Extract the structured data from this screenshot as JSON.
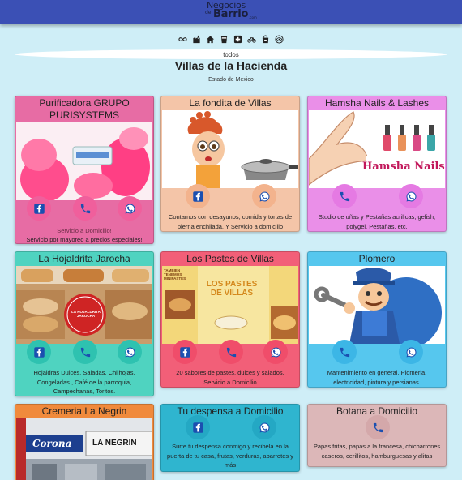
{
  "header": {
    "logo_line1": "Negocios",
    "logo_del": "del",
    "logo_line2": "Barrio",
    "logo_tld": ".com"
  },
  "categories": [
    {
      "name": "infinity-icon",
      "label": "todos"
    },
    {
      "name": "store-icon",
      "label": "tiendas"
    },
    {
      "name": "house-icon",
      "label": "hogar"
    },
    {
      "name": "cup-icon",
      "label": "bebidas"
    },
    {
      "name": "medical-icon",
      "label": "salud"
    },
    {
      "name": "bicycle-icon",
      "label": "transporte"
    },
    {
      "name": "bag-icon",
      "label": "compras"
    },
    {
      "name": "eye-icon",
      "label": "belleza"
    }
  ],
  "filter_label": "todos",
  "page_title": "Villas de la Hacienda",
  "page_subtitle": "Estado de Mexico",
  "colors": {
    "topbar": "#3b50b5",
    "background": "#cfeef7",
    "facebook": "#1877f2",
    "whatsapp": "#25a244",
    "phone": "#3a6df0"
  },
  "cards": [
    {
      "title": "Purificadora GRUPO PURISYSTEMS",
      "image": "water-bottles-photo",
      "description": "Servicio a Domicilio!",
      "description2": "Servicio por mayoreo a precios especiales!"
    },
    {
      "title": "La fondita de Villas",
      "image": "cook-cartoon-image",
      "description": "Contamos con desayunos, comida y tortas de pierna enchilada. Y Servicio a domicilio"
    },
    {
      "title": "Hamsha Nails & Lashes",
      "image": "nail-polish-image",
      "image_text": "Hamsha Nails",
      "description": "Studio de uñas y Pestañas acrilicas, gelish, polygel, Pestañas, etc."
    },
    {
      "title": "La Hojaldrita Jarocha",
      "image": "bread-photo",
      "image_text": "LA HOJALDRITA JAROCHA",
      "description": "Hojaldras Dulces, Saladas, Chilhojas, Congeladas , Café de la parroquia, Campechanas, Toritos."
    },
    {
      "title": "Los Pastes de Villas",
      "image": "pastes-flyer",
      "image_text": "LOS PASTES DE VILLAS",
      "image_text_left": "TAMBIEN TENEMOS MINIPASTES",
      "description": "20 sabores de pastes, dulces y salados. Servicio a Domicilio"
    },
    {
      "title": "Plomero",
      "image": "plumber-cartoon-image",
      "description": "Mantenimiento en general. Plomeria, electricidad, pintura y persianas."
    },
    {
      "title": "Cremeria La Negrin",
      "image": "storefront-photo",
      "image_text": "Corona",
      "image_text2": "LA NEGRIN",
      "description": ""
    },
    {
      "title": "Tu despensa a Domicilio",
      "image": "",
      "description": "Surte tu despensa conmigo y recibela en la puerta de tu casa, frutas, verduras, abarrotes y más"
    },
    {
      "title": "Botana a Domicilio",
      "image": "",
      "description": "Papas fritas, papas a la francesa, chicharrones caseros, cerillitos, hamburguesas y alitas"
    }
  ]
}
